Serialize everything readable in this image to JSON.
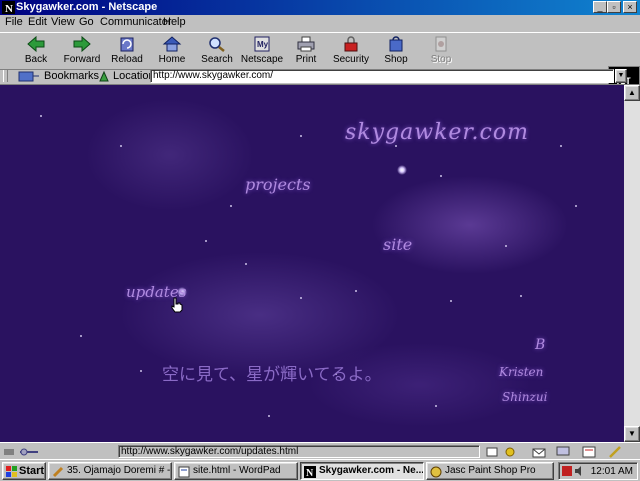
{
  "window": {
    "title": "Skygawker.com - Netscape"
  },
  "menu": [
    {
      "label": "File"
    },
    {
      "label": "Edit"
    },
    {
      "label": "View"
    },
    {
      "label": "Go"
    },
    {
      "label": "Communicator"
    },
    {
      "label": "Help"
    }
  ],
  "toolbar": {
    "back": "Back",
    "forward": "Forward",
    "reload": "Reload",
    "home": "Home",
    "search": "Search",
    "netscape": "Netscape",
    "print": "Print",
    "security": "Security",
    "shop": "Shop",
    "stop": "Stop"
  },
  "location_bar": {
    "bookmarks": "Bookmarks",
    "location_label": "Location:",
    "url": "http://www.skygawker.com/"
  },
  "page": {
    "site_title": "skygawker.com",
    "nav": {
      "projects": "projects",
      "site": "site",
      "updates": "updates"
    },
    "japanese_text": "空に見て、星が輝いてるよ。",
    "signature": {
      "initial": "B",
      "name": "Kristen",
      "surname": "Shinzui"
    }
  },
  "status": {
    "text": "http://www.skygawker.com/updates.html"
  },
  "taskbar": {
    "start": "Start",
    "tasks": [
      {
        "label": "35. Ojamajo Doremi # - P..."
      },
      {
        "label": "site.html - WordPad"
      },
      {
        "label": "Skygawker.com - Ne..."
      },
      {
        "label": "Jasc Paint Shop Pro"
      }
    ],
    "clock": "12:01 AM"
  },
  "colors": {
    "titlebar": "#000080",
    "page_bg": "#2a1260",
    "script_text": "#b08ae0"
  }
}
